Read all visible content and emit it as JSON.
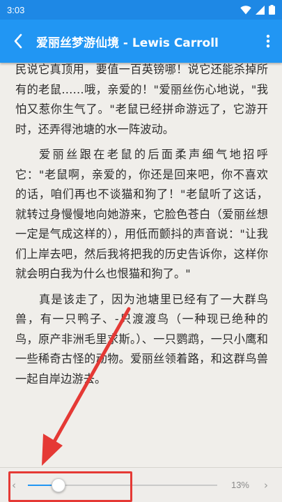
{
  "status_bar": {
    "time": "3:03"
  },
  "app_bar": {
    "title": "爱丽丝梦游仙境 - Lewis Carroll"
  },
  "reader": {
    "paragraphs": [
      "民说它真顶用，要值一百英镑哪！说它还能杀掉所有的老鼠……哦，亲爱的！\"爱丽丝伤心地说，\"我怕又惹你生气了。\"老鼠已经拼命游远了，它游开时，还弄得池塘的水一阵波动。",
      "爱丽丝跟在老鼠的后面柔声细气地招呼它：\"老鼠啊，亲爱的，你还是回来吧，你不喜欢的话，咱们再也不谈猫和狗了！\"老鼠听了这话，就转过身慢慢地向她游来，它脸色苍白（爱丽丝想一定是气成这样的），用低而颤抖的声音说：\"让我们上岸去吧，然后我将把我的历史告诉你，这样你就会明白我为什么也恨猫和狗了。\"",
      "真是该走了，因为池塘里已经有了一大群鸟兽，有一只鸭子、-只渡渡鸟（一种现已绝种的鸟，原产非洲毛里求斯。）、一只鹦鹉，一只小鹰和一些稀奇古怪的动物。爱丽丝领着路，和这群鸟兽一起自岸边游去。"
    ]
  },
  "bottom_bar": {
    "prev_label": "‹",
    "next_label": "›",
    "progress_percent": 13,
    "progress_text": "13%"
  },
  "colors": {
    "accent": "#2196f3",
    "status_bar": "#1e88e5",
    "annotation": "#e53935"
  },
  "icons": [
    "back-arrow-icon",
    "more-vert-icon",
    "wifi-icon",
    "signal-icon",
    "battery-icon"
  ]
}
